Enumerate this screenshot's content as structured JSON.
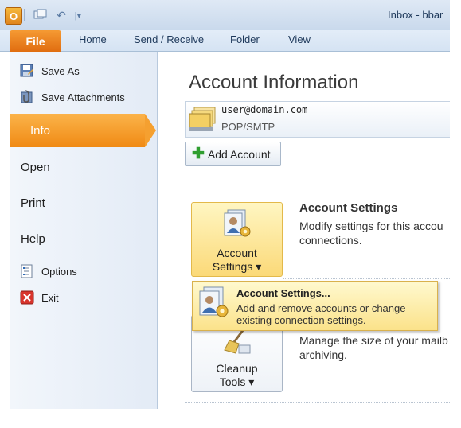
{
  "window": {
    "title": "Inbox - bbar"
  },
  "ribbon": {
    "file_tab": "File",
    "tabs": [
      "Home",
      "Send / Receive",
      "Folder",
      "View"
    ]
  },
  "backstage_nav": {
    "save_as": "Save As",
    "save_attachments": "Save Attachments",
    "info": "Info",
    "open": "Open",
    "print": "Print",
    "help": "Help",
    "options": "Options",
    "exit": "Exit"
  },
  "content": {
    "title": "Account Information",
    "account": {
      "email": "user@domain.com",
      "type": "POP/SMTP"
    },
    "add_account_label": "Add Account",
    "account_settings": {
      "button_line1": "Account",
      "button_line2": "Settings ▾",
      "heading": "Account Settings",
      "description": "Modify settings for this accou connections."
    },
    "cleanup": {
      "button_line1": "Cleanup",
      "button_line2": "Tools ▾",
      "description": "Manage the size of your mailb archiving."
    },
    "dropdown": {
      "item_title": "Account Settings...",
      "item_desc": "Add and remove accounts or change existing connection settings."
    }
  },
  "colors": {
    "accent": "#f08a14",
    "ribbon": "#d5e3f3",
    "highlight": "#fbd978"
  }
}
